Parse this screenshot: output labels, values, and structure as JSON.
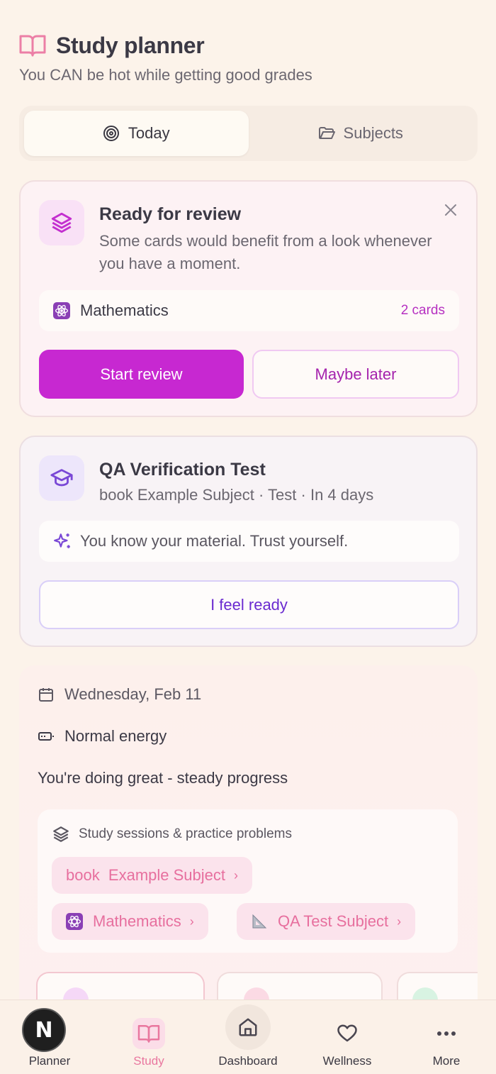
{
  "header": {
    "title": "Study planner",
    "subtitle": "You CAN be hot while getting good grades"
  },
  "tabs": [
    {
      "label": "Today",
      "icon": "target-icon",
      "active": true
    },
    {
      "label": "Subjects",
      "icon": "folder-icon",
      "active": false
    }
  ],
  "review_card": {
    "title": "Ready for review",
    "description": "Some cards would benefit from a look whenever you have a moment.",
    "subject": {
      "name": "Mathematics",
      "count": "2 cards"
    },
    "primary_button": "Start review",
    "secondary_button": "Maybe later",
    "accent": "#c728d1"
  },
  "qa_card": {
    "title": "QA Verification Test",
    "meta": "book Example Subject · Test · In 4 days",
    "tip": "You know your material. Trust yourself.",
    "button": "I feel ready",
    "accent": "#6a2ad0"
  },
  "day": {
    "date": "Wednesday, Feb 11",
    "energy": "Normal energy",
    "progress": "You're doing great - steady progress",
    "sessions_heading": "Study sessions & practice problems",
    "chips": [
      {
        "label": "book  Example Subject"
      },
      {
        "label": "Mathematics"
      },
      {
        "label": "QA Test Subject"
      }
    ]
  },
  "nav": {
    "avatar_letter": "N",
    "items": [
      {
        "label": "Planner"
      },
      {
        "label": "Study",
        "active": true
      },
      {
        "label": "Dashboard"
      },
      {
        "label": "Wellness"
      },
      {
        "label": "More"
      }
    ]
  }
}
